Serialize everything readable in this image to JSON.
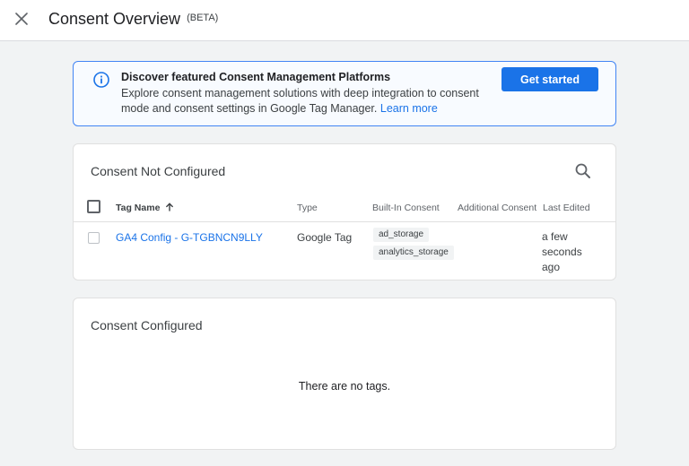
{
  "header": {
    "title": "Consent Overview",
    "badge": "(BETA)",
    "close_icon": "close-icon"
  },
  "banner": {
    "icon": "info-icon",
    "title": "Discover featured Consent Management Platforms",
    "text": "Explore consent management solutions with deep integration to consent mode and consent settings in Google Tag Manager.",
    "link": "Learn more",
    "button": "Get started"
  },
  "not_configured": {
    "title": "Consent Not Configured",
    "search_icon": "search-icon",
    "columns": {
      "tag_name": "Tag Name",
      "sort_icon": "arrow-up-icon",
      "type": "Type",
      "built_in": "Built-In Consent",
      "additional": "Additional Consent",
      "last_edited": "Last Edited"
    },
    "rows": [
      {
        "tag_name": "GA4 Config - G-TGBNCN9LLY",
        "type": "Google Tag",
        "built_in": [
          "ad_storage",
          "analytics_storage"
        ],
        "additional": "",
        "last_edited": "a few seconds ago"
      }
    ]
  },
  "configured": {
    "title": "Consent Configured",
    "empty_message": "There are no tags."
  },
  "colors": {
    "accent": "#1a73e8",
    "background": "#f1f3f4",
    "banner_border": "#4285f4"
  }
}
